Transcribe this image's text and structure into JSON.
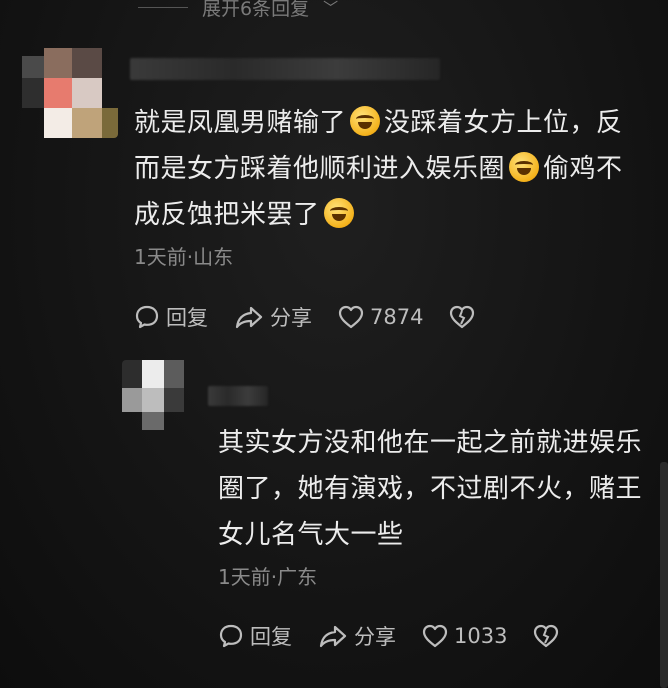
{
  "expand_replies": {
    "label": "展开6条回复"
  },
  "comments": [
    {
      "line1a": "就是凤凰男赌输了",
      "line1b": "没踩着女方上位，反",
      "line2a": "而是女方踩着他顺利进入娱乐圈",
      "line2b": "偷鸡不",
      "line3a": "成反蚀把米罢了",
      "meta": "1天前·山东",
      "reply_label": "回复",
      "share_label": "分享",
      "likes": "7874"
    },
    {
      "line1": "其实女方没和他在一起之前就进娱乐",
      "line2": "圈了，她有演戏，不过剧不火，赌王",
      "line3": "女儿名气大一些",
      "meta": "1天前·广东",
      "reply_label": "回复",
      "share_label": "分享",
      "likes": "1033"
    }
  ],
  "icons": [
    "comment-icon",
    "share-icon",
    "heart-icon",
    "dislike-icon",
    "chevron-down-icon",
    "smile-emoji-icon"
  ]
}
